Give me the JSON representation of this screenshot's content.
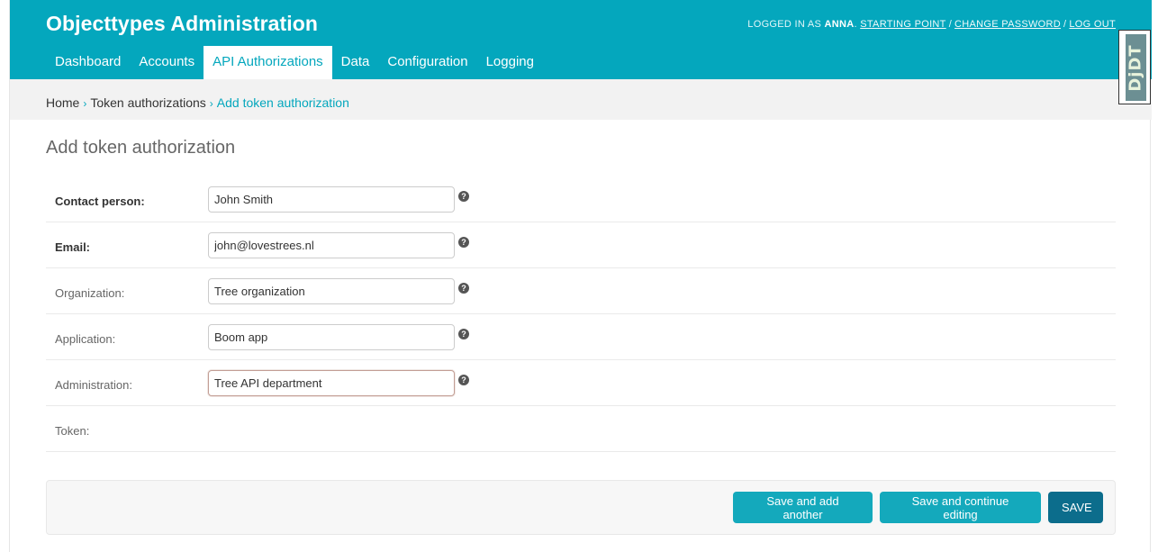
{
  "header": {
    "branding": "Objecttypes Administration",
    "logged_in_prefix": "LOGGED IN AS",
    "username": "ANNA",
    "links": [
      "STARTING POINT",
      "CHANGE PASSWORD",
      "LOG OUT"
    ]
  },
  "nav": {
    "items": [
      "Dashboard",
      "Accounts",
      "API Authorizations",
      "Data",
      "Configuration",
      "Logging"
    ],
    "active_index": 2
  },
  "breadcrumbs": {
    "home": "Home",
    "parent": "Token authorizations",
    "current": "Add token authorization",
    "separator": "›"
  },
  "page": {
    "title": "Add token authorization"
  },
  "form": {
    "contact_person": {
      "label": "Contact person:",
      "value": "John Smith",
      "required": true
    },
    "email": {
      "label": "Email:",
      "value": "john@lovestrees.nl",
      "required": true
    },
    "organization": {
      "label": "Organization:",
      "value": "Tree organization",
      "required": false
    },
    "application": {
      "label": "Application:",
      "value": "Boom app",
      "required": false
    },
    "administration": {
      "label": "Administration:",
      "value": "Tree API department",
      "required": false,
      "focused": true
    },
    "token": {
      "label": "Token:"
    }
  },
  "help_icon_glyph": "?",
  "actions": {
    "save_add_another": "Save and add another",
    "save_continue": "Save and continue editing",
    "save": "SAVE"
  },
  "djdt": {
    "label": "DjDT"
  },
  "colors": {
    "header_bg": "#04a7bd",
    "primary_button": "#0c6d8c",
    "secondary_button": "#14a9bc",
    "breadcrumb_link": "#04a7bd"
  }
}
